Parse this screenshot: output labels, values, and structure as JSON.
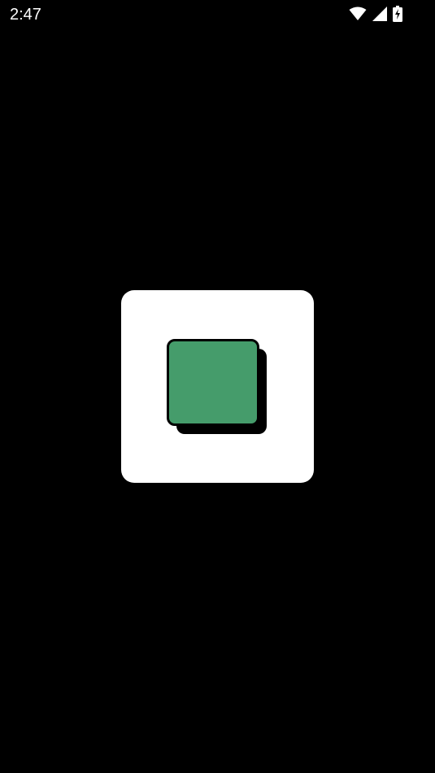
{
  "status_bar": {
    "time": "2:47",
    "icons": [
      "wifi-icon",
      "cellular-signal-icon",
      "battery-charging-icon"
    ]
  },
  "splash": {
    "logo_icon": "app-logo-icon",
    "card_color": "#ffffff",
    "logo_color": "#459c6b",
    "background_color": "#000000"
  }
}
